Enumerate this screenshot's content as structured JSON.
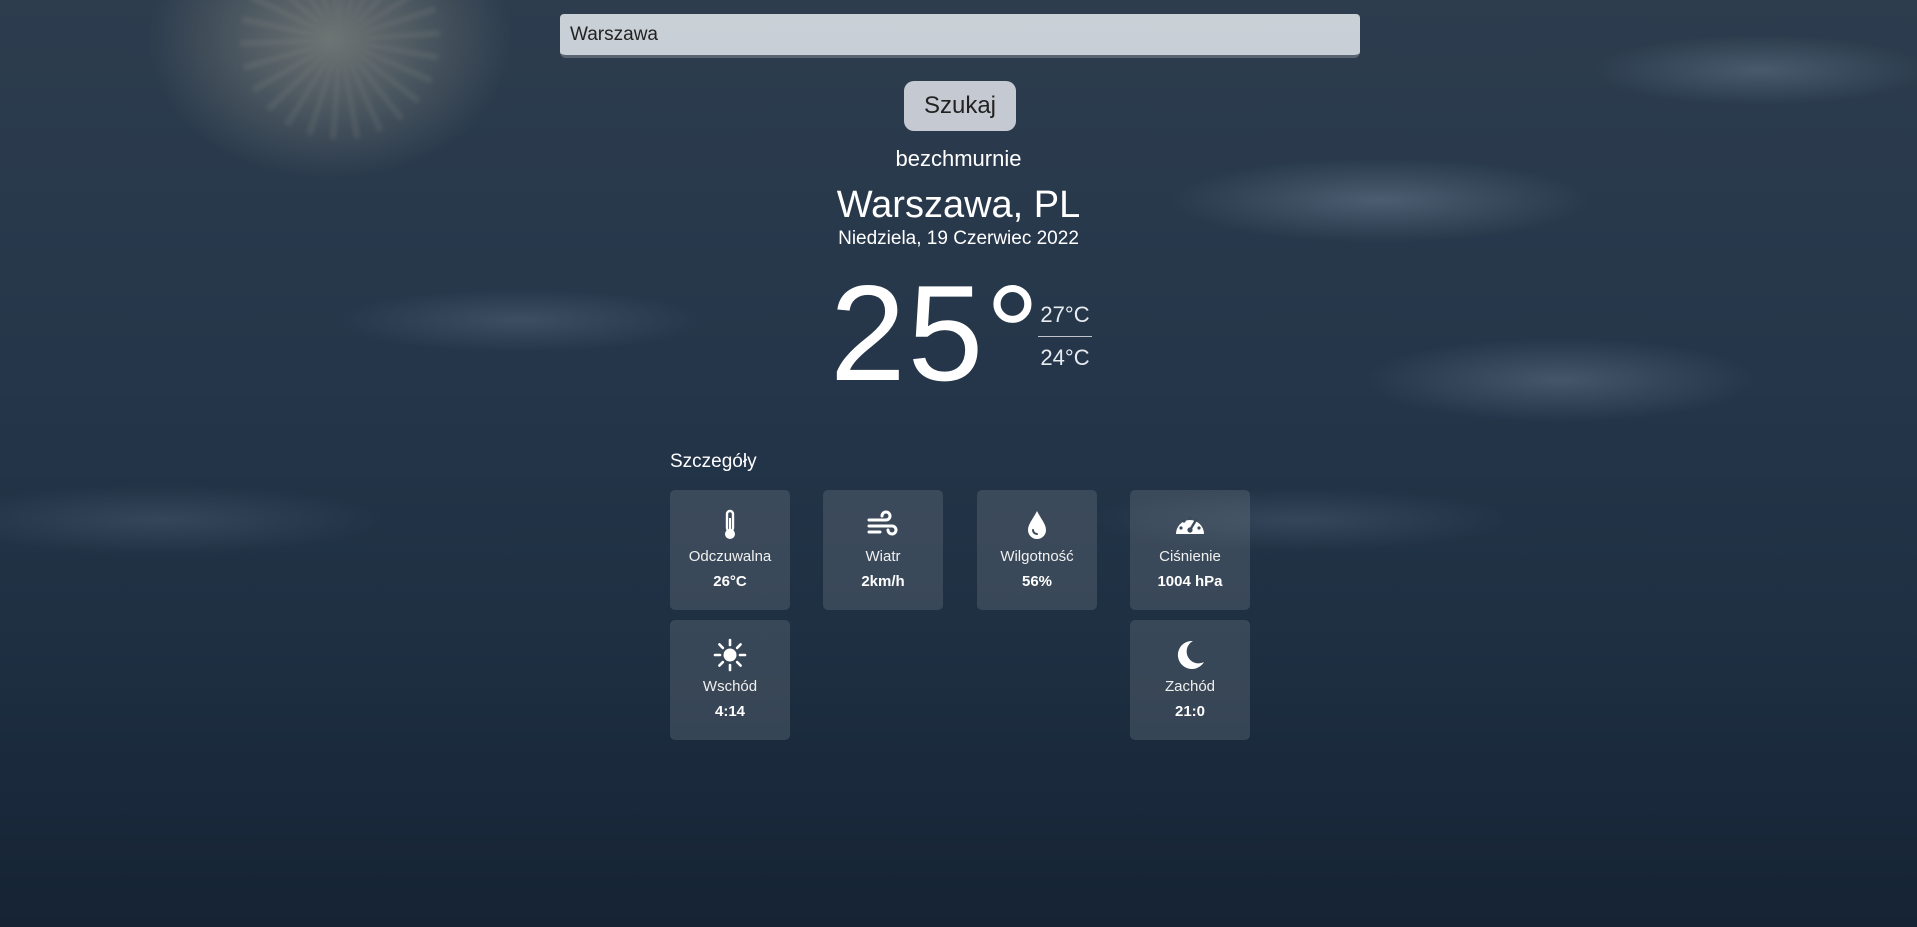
{
  "search": {
    "value": "Warszawa",
    "button_label": "Szukaj"
  },
  "weather": {
    "condition": "bezchmurnie",
    "city": "Warszawa, PL",
    "date": "Niedziela, 19 Czerwiec 2022",
    "temp": "25°",
    "temp_max": "27°C",
    "temp_min": "24°C"
  },
  "details": {
    "title": "Szczegóły",
    "feels_like": {
      "icon": "thermometer-icon",
      "label": "Odczuwalna",
      "value": "26°C"
    },
    "wind": {
      "icon": "wind-icon",
      "label": "Wiatr",
      "value": "2km/h"
    },
    "humidity": {
      "icon": "droplet-icon",
      "label": "Wilgotność",
      "value": "56%"
    },
    "pressure": {
      "icon": "gauge-icon",
      "label": "Ciśnienie",
      "value": "1004 hPa"
    },
    "sunrise": {
      "icon": "sun-icon",
      "label": "Wschód",
      "value": "4:14"
    },
    "sunset": {
      "icon": "moon-icon",
      "label": "Zachód",
      "value": "21:0"
    }
  }
}
